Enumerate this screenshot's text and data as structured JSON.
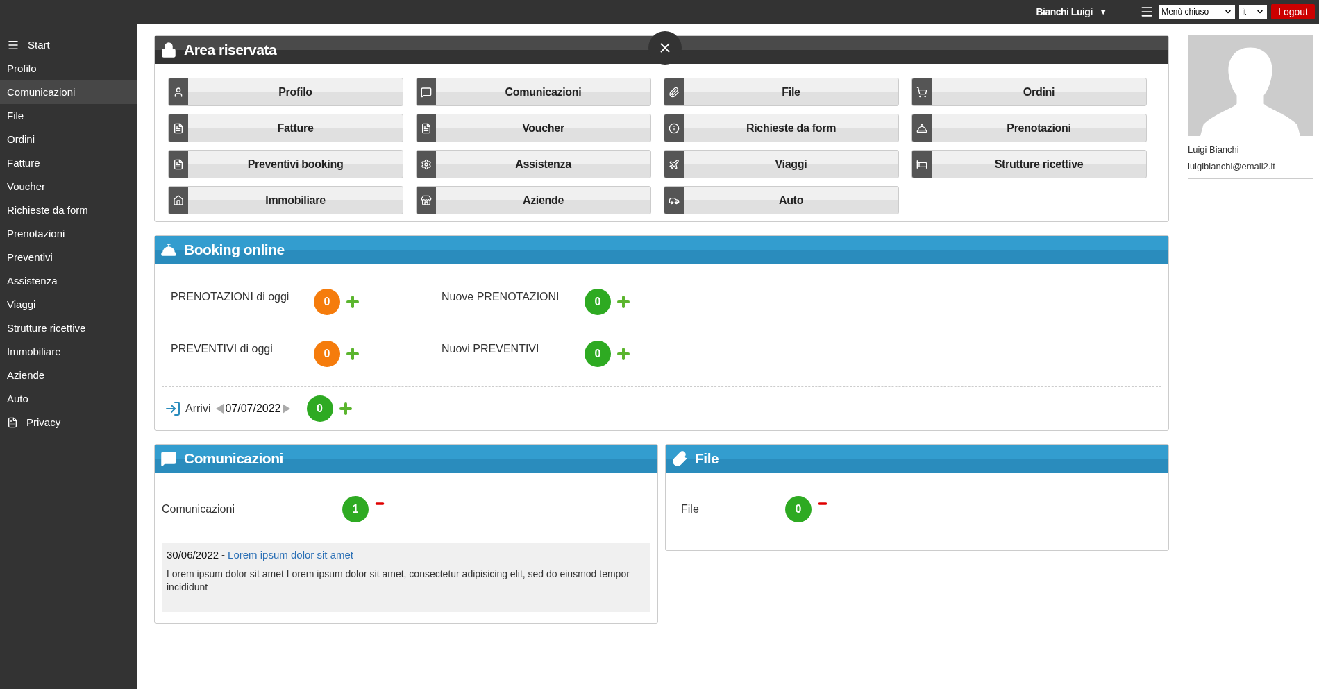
{
  "topbar": {
    "user": "Bianchi Luigi",
    "user_caret": "▼",
    "menu_select": "Menù chiuso",
    "language_select": "it",
    "logout": "Logout"
  },
  "sidebar": {
    "items": [
      {
        "label": "Start",
        "kind": "menu",
        "selected": false
      },
      {
        "label": "Profilo",
        "kind": "plain",
        "selected": false
      },
      {
        "label": "Comunicazioni",
        "kind": "plain",
        "selected": true
      },
      {
        "label": "File",
        "kind": "plain",
        "selected": false
      },
      {
        "label": "Ordini",
        "kind": "plain",
        "selected": false
      },
      {
        "label": "Fatture",
        "kind": "plain",
        "selected": false
      },
      {
        "label": "Voucher",
        "kind": "plain",
        "selected": false
      },
      {
        "label": "Richieste da form",
        "kind": "plain",
        "selected": false
      },
      {
        "label": "Prenotazioni",
        "kind": "plain",
        "selected": false
      },
      {
        "label": "Preventivi",
        "kind": "plain",
        "selected": false
      },
      {
        "label": "Assistenza",
        "kind": "plain",
        "selected": false
      },
      {
        "label": "Viaggi",
        "kind": "plain",
        "selected": false
      },
      {
        "label": "Strutture ricettive",
        "kind": "plain",
        "selected": false
      },
      {
        "label": "Immobiliare",
        "kind": "plain",
        "selected": false
      },
      {
        "label": "Aziende",
        "kind": "plain",
        "selected": false
      },
      {
        "label": "Auto",
        "kind": "plain",
        "selected": false
      },
      {
        "label": "Privacy",
        "kind": "document",
        "selected": false
      }
    ]
  },
  "area_riservata": {
    "title": "Area riservata",
    "buttons": [
      {
        "label": "Profilo"
      },
      {
        "label": "Comunicazioni"
      },
      {
        "label": "File"
      },
      {
        "label": "Ordini"
      },
      {
        "label": "Fatture"
      },
      {
        "label": "Voucher"
      },
      {
        "label": "Richieste da form"
      },
      {
        "label": "Prenotazioni"
      },
      {
        "label": "Preventivi booking"
      },
      {
        "label": "Assistenza"
      },
      {
        "label": "Viaggi"
      },
      {
        "label": "Strutture ricettive"
      },
      {
        "label": "Immobiliare"
      },
      {
        "label": "Aziende"
      },
      {
        "label": "Auto"
      }
    ]
  },
  "booking": {
    "title": "Booking online",
    "counters": [
      {
        "label": "PRENOTAZIONI di oggi",
        "count": "0",
        "color": "#f57c0c"
      },
      {
        "label": "Nuove PRENOTAZIONI",
        "count": "0",
        "color": "#2eaa22"
      },
      {
        "label": "PREVENTIVI di oggi",
        "count": "0",
        "color": "#f57c0c"
      },
      {
        "label": "Nuovi PREVENTIVI",
        "count": "0",
        "color": "#2eaa22"
      }
    ],
    "arrivals": {
      "label": "Arrivi",
      "date": "07/07/2022",
      "count": "0",
      "color": "#2eaa22"
    }
  },
  "comunicazioni": {
    "title": "Comunicazioni",
    "label": "Comunicazioni",
    "count": "1",
    "messages": [
      {
        "date": "30/06/2022",
        "separator": "-",
        "title": "Lorem ipsum dolor sit amet",
        "body": "Lorem ipsum dolor sit amet Lorem ipsum dolor sit amet, consectetur adipisicing elit, sed do eiusmod tempor incididunt"
      }
    ]
  },
  "file": {
    "title": "File",
    "label": "File",
    "count": "0"
  },
  "profile": {
    "name": "Luigi Bianchi",
    "email": "luigibianchi@email2.it"
  }
}
